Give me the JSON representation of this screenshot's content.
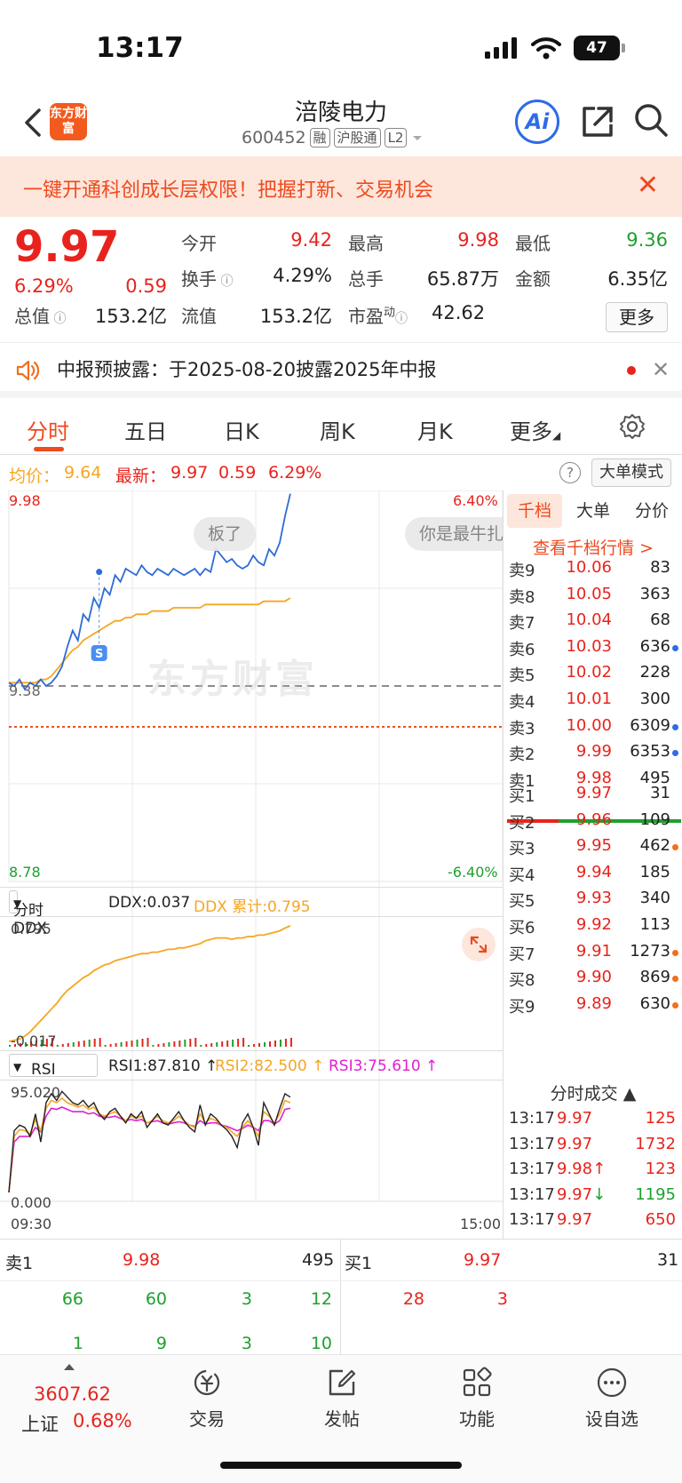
{
  "status": {
    "time": "13:17",
    "battery": "47"
  },
  "header": {
    "logo_text": "东方财富",
    "stock_name": "涪陵电力",
    "stock_code": "600452",
    "tags": [
      "融",
      "沪股通",
      "L2"
    ],
    "ai_label": "Ai"
  },
  "banner": {
    "text": "一键开通科创成长层权限！把握打新、交易机会",
    "close": "✕"
  },
  "quote": {
    "price": "9.97",
    "change_pct": "6.29%",
    "change_amt": "0.59",
    "fields": [
      {
        "label": "今开",
        "value": "9.42",
        "color": "red"
      },
      {
        "label": "最高",
        "value": "9.98",
        "color": "red"
      },
      {
        "label": "最低",
        "value": "9.36",
        "color": "green"
      },
      {
        "label": "换手",
        "value": "4.29%",
        "color": "dark"
      },
      {
        "label": "总手",
        "value": "65.87万",
        "color": "dark"
      },
      {
        "label": "金额",
        "value": "6.35亿",
        "color": "dark"
      },
      {
        "label": "总值",
        "value": "153.2亿",
        "color": "dark"
      },
      {
        "label": "流值",
        "value": "153.2亿",
        "color": "dark"
      },
      {
        "label": "市盈",
        "value": "42.62",
        "color": "dark"
      }
    ],
    "pe_superscript": "动",
    "more_label": "更多"
  },
  "notice": {
    "text": "中报预披露：于2025-08-20披露2025年中报",
    "close": "✕"
  },
  "tabs": [
    "分时",
    "五日",
    "日K",
    "周K",
    "月K",
    "更多"
  ],
  "infobar": {
    "avg_label": "均价：",
    "avg_value": "9.64",
    "latest_label": "最新：",
    "latest_value": "9.97",
    "change_amt": "0.59",
    "change_pct": "6.29%",
    "help": "?",
    "big_order_label": "大单模式"
  },
  "chart": {
    "y_high": "9.98",
    "y_low": "8.78",
    "y_mid": "9.38",
    "pct_high": "6.40%",
    "pct_low": "-6.40%",
    "pill1": "板了",
    "pill2": "你是最牛扎",
    "s_marker": "S",
    "watermark": "东方财富",
    "time_start": "09:30",
    "time_end": "15:00"
  },
  "ddx": {
    "select_label": "分时 DDX",
    "ddx_text": "DDX:0.037",
    "ddx_cum_text": "DDX 累计:0.795",
    "y_high": "0.795",
    "y_low": "-0.017"
  },
  "rsi": {
    "select_label": "RSI",
    "rsi1": "RSI1:87.810 ↑",
    "rsi2": "RSI2:82.500 ↑",
    "rsi3": "RSI3:75.610 ↑",
    "y_high": "95.020",
    "y_low": "0.000"
  },
  "orderbook": {
    "tabs": [
      "千档",
      "大单",
      "分价"
    ],
    "link": "查看千档行情 >",
    "asks": [
      {
        "label": "卖9",
        "price": "10.06",
        "vol": "83",
        "dot": ""
      },
      {
        "label": "卖8",
        "price": "10.05",
        "vol": "363",
        "dot": ""
      },
      {
        "label": "卖7",
        "price": "10.04",
        "vol": "68",
        "dot": ""
      },
      {
        "label": "卖6",
        "price": "10.03",
        "vol": "636",
        "dot": "#2e6be6"
      },
      {
        "label": "卖5",
        "price": "10.02",
        "vol": "228",
        "dot": ""
      },
      {
        "label": "卖4",
        "price": "10.01",
        "vol": "300",
        "dot": ""
      },
      {
        "label": "卖3",
        "price": "10.00",
        "vol": "6309",
        "dot": "#2e6be6"
      },
      {
        "label": "卖2",
        "price": "9.99",
        "vol": "6353",
        "dot": "#2e6be6"
      },
      {
        "label": "卖1",
        "price": "9.98",
        "vol": "495",
        "dot": ""
      }
    ],
    "bids": [
      {
        "label": "买1",
        "price": "9.97",
        "vol": "31",
        "dot": ""
      },
      {
        "label": "买2",
        "price": "9.96",
        "vol": "109",
        "dot": ""
      },
      {
        "label": "买3",
        "price": "9.95",
        "vol": "462",
        "dot": "#f0701e"
      },
      {
        "label": "买4",
        "price": "9.94",
        "vol": "185",
        "dot": ""
      },
      {
        "label": "买5",
        "price": "9.93",
        "vol": "340",
        "dot": ""
      },
      {
        "label": "买6",
        "price": "9.92",
        "vol": "113",
        "dot": ""
      },
      {
        "label": "买7",
        "price": "9.91",
        "vol": "1273",
        "dot": "#f0701e"
      },
      {
        "label": "买8",
        "price": "9.90",
        "vol": "869",
        "dot": "#f0701e"
      },
      {
        "label": "买9",
        "price": "9.89",
        "vol": "630",
        "dot": "#f0701e"
      }
    ],
    "trades_head": "分时成交 ▲",
    "trades": [
      {
        "time": "13:17",
        "price": "9.97",
        "vol": "125",
        "vol_color": "red"
      },
      {
        "time": "13:17",
        "price": "9.97",
        "vol": "1732",
        "vol_color": "red"
      },
      {
        "time": "13:17",
        "price": "9.98↑",
        "vol": "123",
        "vol_color": "red"
      },
      {
        "time": "13:17",
        "price": "9.97↓",
        "vol": "1195",
        "vol_color": "green"
      },
      {
        "time": "13:17",
        "price": "9.97",
        "vol": "650",
        "vol_color": "red"
      }
    ]
  },
  "level": {
    "ask1_label": "卖1",
    "ask1_price": "9.98",
    "ask1_vol": "495",
    "bid1_label": "买1",
    "bid1_price": "9.97",
    "bid1_vol": "31",
    "ask_row1": [
      "66",
      "60",
      "3",
      "12"
    ],
    "ask_row2": [
      "1",
      "9",
      "3",
      "10"
    ],
    "bid_row1": [
      "28",
      "3"
    ]
  },
  "bottom": {
    "index_value": "3607.62",
    "index_name": "上证",
    "index_pct": "0.68%",
    "items": [
      "交易",
      "发帖",
      "功能",
      "设自选"
    ]
  },
  "chart_data": {
    "type": "line",
    "x_range": [
      "09:30",
      "15:00"
    ],
    "price_ylim": [
      8.78,
      9.98
    ],
    "price_series": [
      9.39,
      9.38,
      9.4,
      9.37,
      9.39,
      9.38,
      9.4,
      9.38,
      9.39,
      9.41,
      9.44,
      9.5,
      9.55,
      9.52,
      9.6,
      9.58,
      9.65,
      9.62,
      9.68,
      9.66,
      9.72,
      9.7,
      9.74,
      9.73,
      9.72,
      9.75,
      9.73,
      9.72,
      9.74,
      9.73,
      9.72,
      9.74,
      9.73,
      9.72,
      9.73,
      9.74,
      9.72,
      9.74,
      9.73,
      9.8,
      9.78,
      9.76,
      9.77,
      9.75,
      9.74,
      9.75,
      9.78,
      9.76,
      9.75,
      9.8,
      9.78,
      9.82,
      9.9,
      9.97
    ],
    "avg_series": [
      9.39,
      9.39,
      9.39,
      9.39,
      9.39,
      9.39,
      9.4,
      9.4,
      9.41,
      9.43,
      9.45,
      9.47,
      9.49,
      9.5,
      9.52,
      9.53,
      9.54,
      9.55,
      9.56,
      9.57,
      9.58,
      9.58,
      9.59,
      9.59,
      9.6,
      9.6,
      9.6,
      9.61,
      9.61,
      9.61,
      9.61,
      9.62,
      9.62,
      9.62,
      9.62,
      9.62,
      9.62,
      9.63,
      9.63,
      9.63,
      9.63,
      9.63,
      9.63,
      9.63,
      9.63,
      9.63,
      9.63,
      9.63,
      9.64,
      9.64,
      9.64,
      9.64,
      9.64,
      9.65
    ],
    "ddx_ylim": [
      -0.017,
      0.795
    ],
    "ddx_series": [
      -0.017,
      -0.01,
      0.0,
      0.02,
      0.05,
      0.09,
      0.13,
      0.17,
      0.21,
      0.25,
      0.3,
      0.34,
      0.37,
      0.4,
      0.43,
      0.45,
      0.48,
      0.5,
      0.52,
      0.53,
      0.55,
      0.56,
      0.57,
      0.58,
      0.59,
      0.6,
      0.6,
      0.61,
      0.61,
      0.62,
      0.63,
      0.63,
      0.64,
      0.64,
      0.65,
      0.66,
      0.67,
      0.69,
      0.7,
      0.71,
      0.71,
      0.71,
      0.7,
      0.71,
      0.71,
      0.72,
      0.72,
      0.73,
      0.73,
      0.74,
      0.75,
      0.76,
      0.78,
      0.795
    ],
    "rsi_ylim": [
      0,
      95.02
    ],
    "rsi1": [
      0,
      55,
      60,
      58,
      50,
      70,
      45,
      80,
      88,
      82,
      90,
      85,
      80,
      78,
      82,
      76,
      80,
      70,
      65,
      72,
      75,
      68,
      62,
      70,
      66,
      72,
      58,
      64,
      70,
      62,
      60,
      66,
      72,
      64,
      58,
      54,
      78,
      60,
      70,
      66,
      60,
      56,
      50,
      40,
      62,
      70,
      58,
      42,
      80,
      70,
      60,
      75,
      88,
      85
    ],
    "rsi2": [
      0,
      50,
      56,
      55,
      52,
      65,
      55,
      75,
      82,
      80,
      84,
      80,
      78,
      76,
      78,
      74,
      76,
      70,
      68,
      70,
      72,
      68,
      64,
      68,
      66,
      68,
      62,
      64,
      68,
      64,
      62,
      64,
      68,
      64,
      60,
      58,
      70,
      62,
      66,
      64,
      60,
      58,
      54,
      50,
      58,
      64,
      58,
      50,
      72,
      68,
      62,
      70,
      82,
      80
    ],
    "rsi3": [
      0,
      45,
      50,
      50,
      50,
      58,
      54,
      68,
      75,
      74,
      76,
      74,
      72,
      72,
      72,
      70,
      71,
      68,
      67,
      67,
      68,
      66,
      64,
      65,
      64,
      65,
      62,
      63,
      64,
      62,
      61,
      62,
      63,
      62,
      60,
      59,
      64,
      61,
      62,
      62,
      60,
      59,
      57,
      55,
      57,
      60,
      58,
      55,
      64,
      64,
      61,
      64,
      74,
      75
    ]
  }
}
